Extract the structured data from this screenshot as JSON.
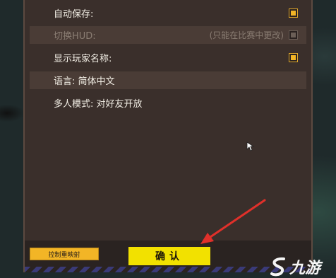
{
  "settings": {
    "items": [
      {
        "label": "自动保存:",
        "note": "",
        "checked": true,
        "disabled": false
      },
      {
        "label": "切换HUD:",
        "note": "(只能在比赛中更改)",
        "checked": true,
        "disabled": true
      },
      {
        "label": "显示玩家名称:",
        "note": "",
        "checked": true,
        "disabled": false
      },
      {
        "label": "语言: 简体中文",
        "note": "",
        "checked": null,
        "disabled": false
      },
      {
        "label": "多人模式: 对好友开放",
        "note": "",
        "checked": null,
        "disabled": false
      }
    ]
  },
  "footer": {
    "controls_label": "控制重映射",
    "confirm_label": "确认"
  },
  "watermark": {
    "brand": "九游",
    "mark": "S"
  },
  "colors": {
    "accent": "#f2b526",
    "confirm": "#f2e100",
    "annotation_arrow": "#e0302a"
  }
}
